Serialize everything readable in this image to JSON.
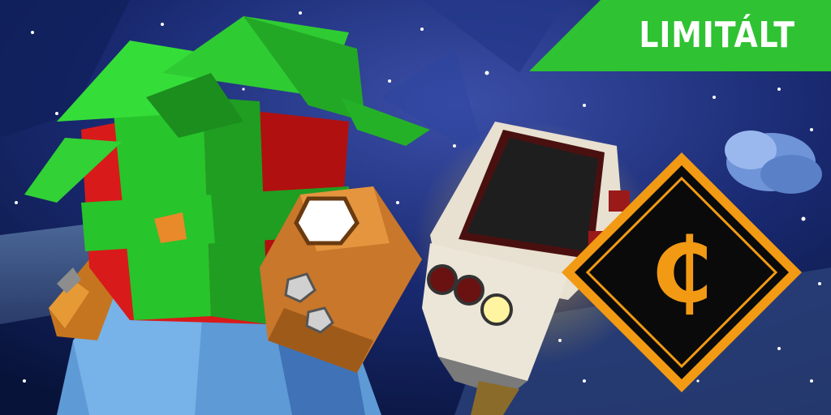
{
  "promo": {
    "badge_label": "LIMITÁLT",
    "currency_glyph": "₵"
  },
  "colors": {
    "badge_green": "#2fc232",
    "coin_orange": "#f29a14",
    "coin_dark": "#0a0a0a",
    "sky_deep": "#0c1a4a",
    "gift_red": "#d61818",
    "ribbon_green": "#27d12a"
  },
  "icons": [
    "gift-box-hat-icon",
    "wrench-glove-icon",
    "tv-monitor-head-icon",
    "currency-coin-icon",
    "limited-badge"
  ]
}
